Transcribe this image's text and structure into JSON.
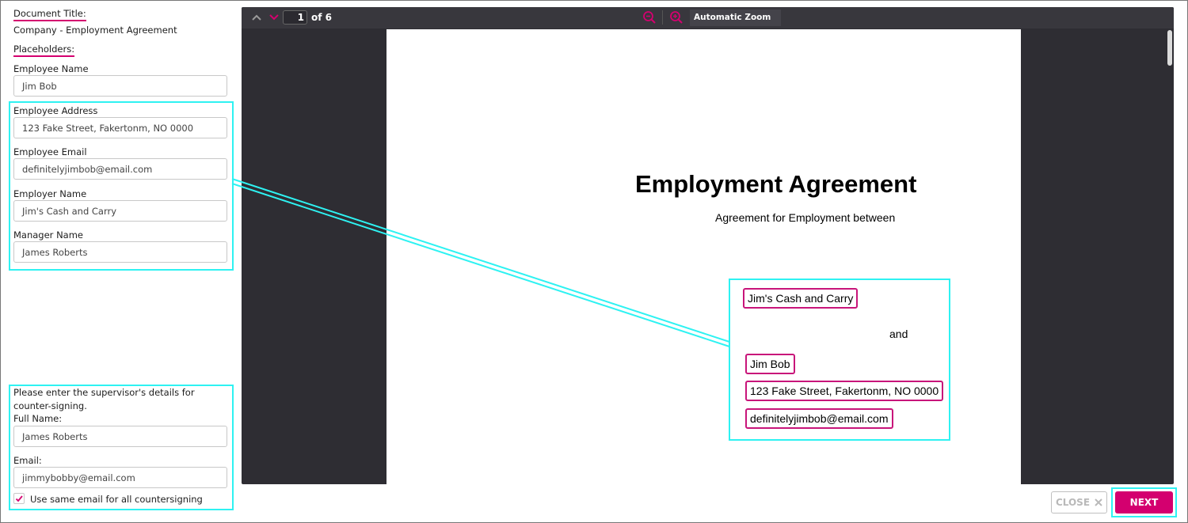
{
  "sidebar": {
    "doc_title_heading": "Document Title:",
    "doc_title_value": "Company - Employment Agreement",
    "placeholders_heading": "Placeholders:",
    "fields": [
      {
        "label": "Employee Name",
        "value": "Jim Bob"
      },
      {
        "label": "Employee Address",
        "value": "123 Fake Street, Fakertonm, NO 0000"
      },
      {
        "label": "Employee Email",
        "value": "definitelyjimbob@email.com"
      },
      {
        "label": "Employer Name",
        "value": "Jim's Cash and Carry"
      },
      {
        "label": "Manager Name",
        "value": "James Roberts"
      }
    ],
    "supervisor": {
      "prompt_line1": "Please enter the supervisor's details for",
      "prompt_line2": "counter-signing.",
      "full_name_label": "Full Name:",
      "full_name_value": "James Roberts",
      "email_label": "Email:",
      "email_value": "jimmybobby@email.com",
      "checkbox_label": "Use same email for all countersigning",
      "checkbox_checked": true
    }
  },
  "viewer": {
    "page_current": "1",
    "page_total_text": "of 6",
    "zoom_label": "Automatic Zoom",
    "document": {
      "title": "Employment Agreement",
      "subtitle": "Agreement for Employment between",
      "employer_name": "Jim's Cash and Carry",
      "and_text": "and",
      "employee_name": "Jim Bob",
      "employee_address": "123 Fake Street, Fakertonm, NO 0000",
      "employee_email": "definitelyjimbob@email.com"
    }
  },
  "footer": {
    "close_label": "CLOSE",
    "next_label": "NEXT"
  },
  "colors": {
    "accent": "#d4006f",
    "highlight": "#2ef2f2",
    "viewer_bg": "#2e2d33"
  }
}
